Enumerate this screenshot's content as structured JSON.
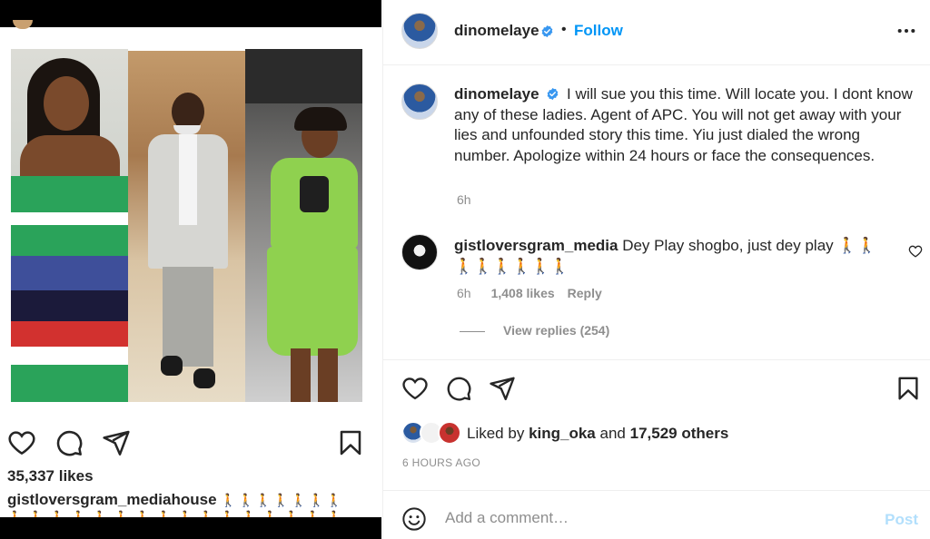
{
  "left": {
    "likes": "35,337 likes",
    "caption_user": "gistloversgram_mediahouse",
    "caption_emoji_row1": "🚶🚶🚶🚶🚶🚶🚶",
    "caption_emoji_row2": "🚶🚶🚶🚶🚶🚶🚶🚶🚶🚶🚶🚶🚶🚶🚶🚶"
  },
  "header": {
    "username": "dinomelaye",
    "separator": "•",
    "follow_label": "Follow"
  },
  "caption": {
    "username": "dinomelaye",
    "text": "I will sue you this time. Will locate you. I dont know any of these ladies. Agent of APC. You will not get away with your lies and unfounded story this time. Yiu just dialed the wrong number. Apologize within 24 hours or face the consequences.",
    "time": "6h"
  },
  "comment": {
    "username": "gistloversgram_media",
    "text": "Dey Play shogbo, just dey play 🚶🚶🚶🚶🚶🚶🚶🚶",
    "time": "6h",
    "likes": "1,408 likes",
    "reply_label": "Reply"
  },
  "view_replies": "View replies (254)",
  "liked_by": {
    "prefix": "Liked by",
    "user": "king_oka",
    "middle": "and",
    "others": "17,529 others"
  },
  "time_ago": "6 HOURS AGO",
  "add_comment": {
    "placeholder": "Add a comment…",
    "post_label": "Post"
  },
  "colors": {
    "accent": "#0095f6",
    "post_disabled": "#b2dffc",
    "muted": "#8e8e8e",
    "verified": "#3897f0"
  },
  "icons": [
    "heart-icon",
    "comment-icon",
    "share-icon",
    "bookmark-icon",
    "more-icon",
    "verified-icon",
    "emoji-icon"
  ]
}
